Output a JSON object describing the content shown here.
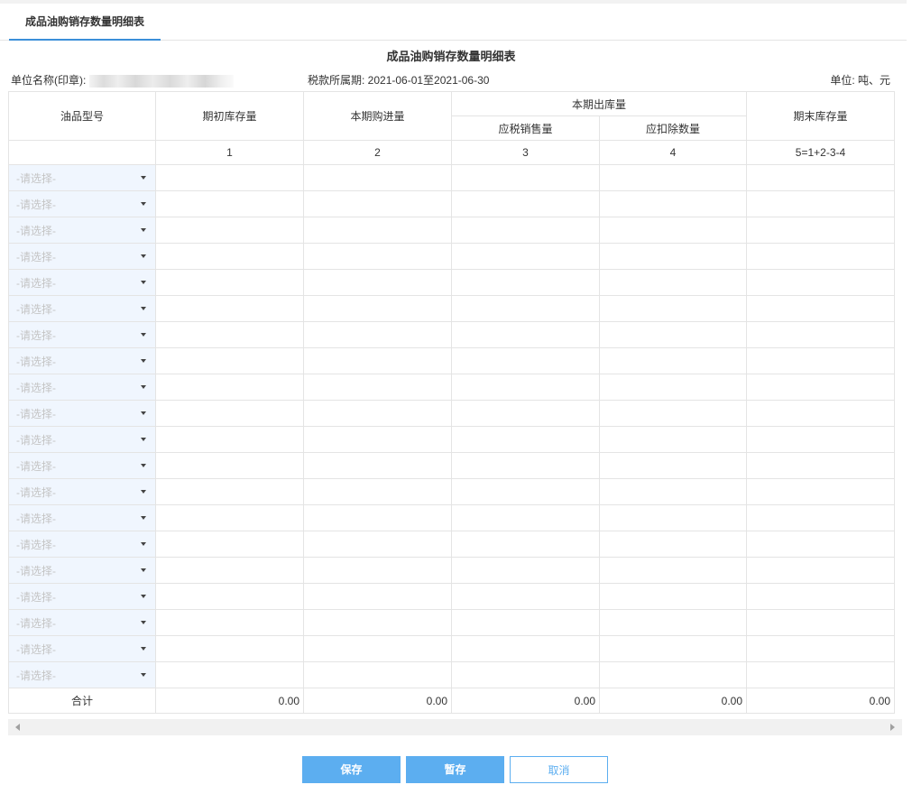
{
  "tab": {
    "label": "成品油购销存数量明细表"
  },
  "title": "成品油购销存数量明细表",
  "meta": {
    "unit_name_label": "单位名称(印章):",
    "period": "税款所属期: 2021-06-01至2021-06-30",
    "units": "单位: 吨、元"
  },
  "table": {
    "headers": {
      "oil_type": "油品型号",
      "opening": "期初库存量",
      "purchase": "本期购进量",
      "outbound": "本期出库量",
      "taxable_sales": "应税销售量",
      "deduction": "应扣除数量",
      "closing": "期末库存量"
    },
    "col_numbers": [
      "1",
      "2",
      "3",
      "4",
      "5=1+2-3-4"
    ],
    "select_placeholder": "-请选择-",
    "row_count": 20,
    "total": {
      "label": "合计",
      "values": [
        "0.00",
        "0.00",
        "0.00",
        "0.00",
        "0.00"
      ]
    }
  },
  "buttons": {
    "save": "保存",
    "temp_save": "暂存",
    "cancel": "取消"
  }
}
